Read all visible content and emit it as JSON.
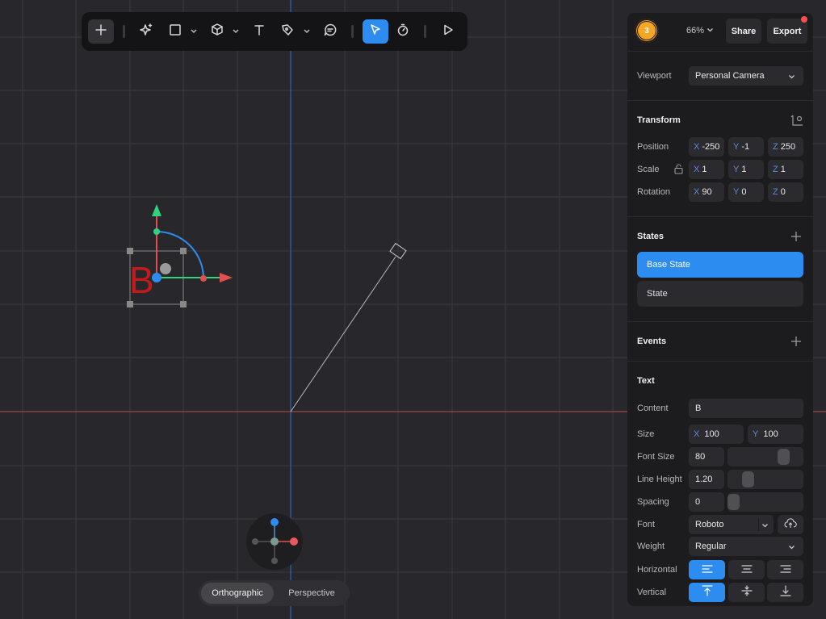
{
  "toolbar": {
    "tools": [
      "add",
      "ai-sparkle",
      "rectangle",
      "cube",
      "text",
      "pen",
      "comment",
      "select",
      "timer",
      "play"
    ]
  },
  "canvas": {
    "selected_text": "B",
    "text_color": "#c41a1a",
    "x_axis_color": "#e05050",
    "y_axis_color": "#2d8cf0"
  },
  "header": {
    "avatar_label": "3",
    "zoom": "66%",
    "share_label": "Share",
    "export_label": "Export"
  },
  "viewport": {
    "label": "Viewport",
    "value": "Personal Camera"
  },
  "transform": {
    "title": "Transform",
    "position": {
      "label": "Position",
      "x_axis": "X",
      "x": "-250",
      "y_axis": "Y",
      "y": "-1",
      "z_axis": "Z",
      "z": "250"
    },
    "scale": {
      "label": "Scale",
      "x_axis": "X",
      "x": "1",
      "y_axis": "Y",
      "y": "1",
      "z_axis": "Z",
      "z": "1"
    },
    "rotation": {
      "label": "Rotation",
      "x_axis": "X",
      "x": "90",
      "y_axis": "Y",
      "y": "0",
      "z_axis": "Z",
      "z": "0"
    }
  },
  "states": {
    "title": "States",
    "items": [
      "Base State",
      "State"
    ]
  },
  "events": {
    "title": "Events"
  },
  "text_props": {
    "title": "Text",
    "content_label": "Content",
    "content": "B",
    "size_label": "Size",
    "size_x_axis": "X",
    "size_x": "100",
    "size_y_axis": "Y",
    "size_y": "100",
    "font_size_label": "Font Size",
    "font_size": "80",
    "line_height_label": "Line Height",
    "line_height": "1.20",
    "spacing_label": "Spacing",
    "spacing": "0",
    "font_label": "Font",
    "font": "Roboto",
    "weight_label": "Weight",
    "weight": "Regular",
    "horizontal_label": "Horizontal",
    "vertical_label": "Vertical"
  },
  "view_toggle": {
    "options": [
      "Orthographic",
      "Perspective"
    ],
    "active": "Orthographic"
  },
  "colors": {
    "accent": "#2d8cf0",
    "avatar": "#f5a623",
    "notification": "#ff4d4d"
  }
}
